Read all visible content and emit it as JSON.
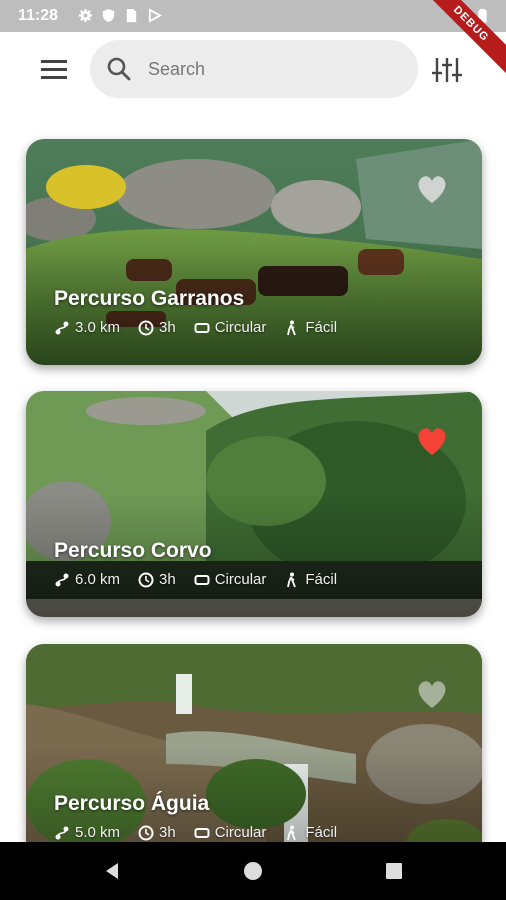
{
  "status_bar": {
    "time": "11:28",
    "debug_label": "DEBUG",
    "icons": [
      "gear-icon",
      "shield-icon",
      "sim-icon",
      "play-protect-icon",
      "wifi-icon",
      "battery-icon"
    ]
  },
  "app_bar": {
    "search_placeholder": "Search",
    "menu_icon": "menu-icon",
    "filter_icon": "tune-icon"
  },
  "trails": [
    {
      "name": "Percurso Garranos",
      "distance": "3.0 km",
      "duration": "3h",
      "type": "Circular",
      "difficulty": "Fácil",
      "favorite": false,
      "scene": "horses on hill"
    },
    {
      "name": "Percurso Corvo",
      "distance": "6.0 km",
      "duration": "3h",
      "type": "Circular",
      "difficulty": "Fácil",
      "favorite": true,
      "scene": "green forest"
    },
    {
      "name": "Percurso Águia",
      "distance": "5.0 km",
      "duration": "3h",
      "type": "Circular",
      "difficulty": "Fácil",
      "favorite": false,
      "scene": "waterfall stream"
    }
  ],
  "colors": {
    "favorite_active": "#f44336",
    "favorite_inactive": "#e0e0e0",
    "search_bg": "#ececec"
  },
  "nav_bar": {
    "icons": [
      "back-icon",
      "home-icon",
      "recents-icon"
    ]
  }
}
